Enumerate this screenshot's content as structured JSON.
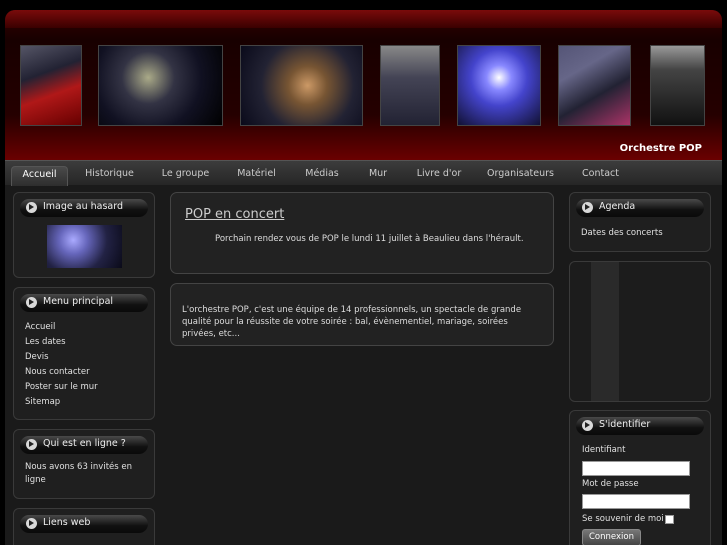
{
  "header": {
    "site_title": "Orchestre POP"
  },
  "nav": [
    "Accueil",
    "Historique",
    "Le groupe",
    "Matériel",
    "Médias",
    "Mur",
    "Livre d'or",
    "Organisateurs",
    "Contact"
  ],
  "left": {
    "random_image": {
      "title": "Image au hasard"
    },
    "main_menu": {
      "title": "Menu principal",
      "items": [
        "Accueil",
        "Les dates",
        "Devis",
        "Nous contacter",
        "Poster sur le mur",
        "Sitemap"
      ]
    },
    "online": {
      "title": "Qui est en ligne ?",
      "text": "Nous avons 63 invités en ligne"
    },
    "links": {
      "title": "Liens web"
    }
  },
  "main": {
    "article1": {
      "title": "POP en concert",
      "text": "Porchain rendez vous de POP le lundi 11 juillet à Beaulieu dans l'hérault."
    },
    "article2": {
      "text": "L'orchestre POP, c'est une équipe de 14 professionnels, un spectacle de grande qualité pour la réussite de votre soirée : bal, évènementiel, mariage, soirées privées, etc..."
    }
  },
  "right": {
    "agenda": {
      "title": "Agenda",
      "link": "Dates des concerts"
    },
    "login": {
      "title": "S'identifier",
      "user_label": "Identifiant",
      "pass_label": "Mot de passe",
      "remember_label": "Se souvenir de moi",
      "submit": "Connexion"
    }
  },
  "colors": {
    "header_red": "#5a0000",
    "background": "#1a1a1a"
  }
}
